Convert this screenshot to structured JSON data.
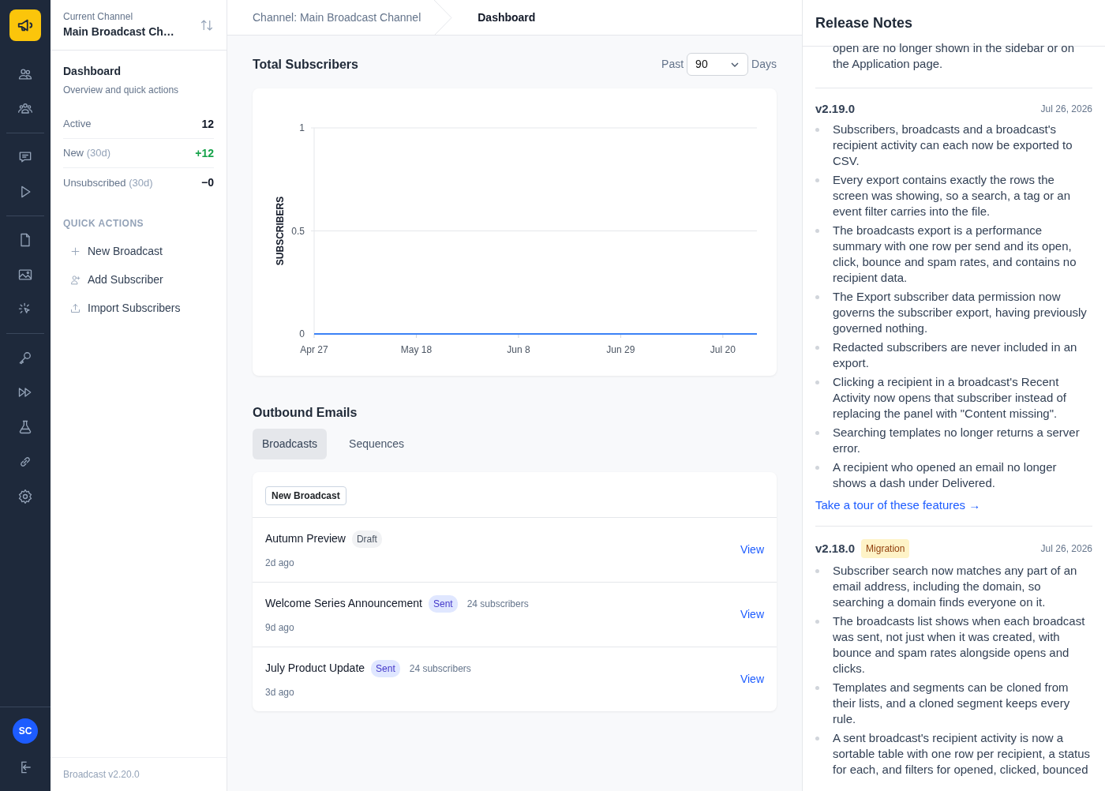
{
  "rail": {
    "avatar": "SC"
  },
  "sidebar": {
    "channel_label": "Current Channel",
    "channel_name": "Main Broadcast Ch…",
    "title": "Dashboard",
    "subtitle": "Overview and quick actions",
    "stats": [
      {
        "label": "Active",
        "value": "12",
        "kind": "plain"
      },
      {
        "label": "New",
        "qualifier": "(30d)",
        "value": "+12",
        "kind": "positive"
      },
      {
        "label": "Unsubscribed",
        "qualifier": "(30d)",
        "value": "−0",
        "kind": "plain"
      }
    ],
    "quick_actions_heading": "QUICK ACTIONS",
    "quick_actions": [
      {
        "label": "New Broadcast",
        "kind": "plus"
      },
      {
        "label": "Add Subscriber",
        "kind": "user"
      },
      {
        "label": "Import Subscribers",
        "kind": "upload"
      }
    ],
    "version": "Broadcast v2.20.0"
  },
  "breadcrumb": [
    "Channel: Main Broadcast Channel",
    "Dashboard"
  ],
  "subscribers": {
    "title": "Total Subscribers",
    "range_prefix": "Past",
    "range_value": "90",
    "range_suffix": "Days",
    "chart_data": {
      "type": "line",
      "ylabel": "SUBSCRIBERS",
      "categories": [
        "Apr 27",
        null,
        null,
        "May 18",
        null,
        null,
        "Jun 8",
        null,
        null,
        "Jun 29",
        null,
        null,
        "Jul 20",
        null
      ],
      "ylim": [
        0,
        1
      ],
      "yticks": [
        0,
        {
          "value": 0.5,
          "label": "0.5"
        },
        1
      ],
      "series": [
        {
          "color": "#3b82f6",
          "values": [
            0,
            0,
            0,
            0,
            0,
            0,
            0,
            0,
            0,
            0,
            0,
            0,
            0,
            0
          ]
        }
      ]
    }
  },
  "outbound": {
    "title": "Outbound Emails",
    "tabs": [
      {
        "label": "Broadcasts",
        "selected": true
      },
      {
        "label": "Sequences",
        "selected": false
      }
    ],
    "new_button": "New Broadcast",
    "broadcasts": [
      {
        "title": "Autumn Preview",
        "status": "Draft",
        "kind": "draft",
        "time": "2d ago",
        "action": "View"
      },
      {
        "title": "Welcome Series Announcement",
        "status": "Sent",
        "kind": "sent",
        "subscribers": "24 subscribers",
        "time": "9d ago",
        "action": "View"
      },
      {
        "title": "July Product Update",
        "status": "Sent",
        "kind": "sent",
        "subscribers": "24 subscribers",
        "time": "3d ago",
        "action": "View"
      }
    ]
  },
  "release_notes": {
    "title": "Release Notes",
    "leading_text": "open are no longer shown in the sidebar or on the Application page.",
    "releases": [
      {
        "version": "v2.19.0",
        "date": "Jul 26, 2026",
        "items": [
          "Subscribers, broadcasts and a broadcast's recipient activity can each now be exported to CSV.",
          "Every export contains exactly the rows the screen was showing, so a search, a tag or an event filter carries into the file.",
          "The broadcasts export is a performance summary with one row per send and its open, click, bounce and spam rates, and contains no recipient data.",
          "The Export subscriber data permission now governs the subscriber export, having previously governed nothing.",
          "Redacted subscribers are never included in an export.",
          "Clicking a recipient in a broadcast's Recent Activity now opens that subscriber instead of replacing the panel with \"Content missing\".",
          "Searching templates no longer returns a server error.",
          "A recipient who opened an email no longer shows a dash under Delivered."
        ],
        "link": "Take a tour of these features →"
      },
      {
        "version": "v2.18.0",
        "tag": "Migration",
        "date": "Jul 26, 2026",
        "items": [
          "Subscriber search now matches any part of an email address, including the domain, so searching a domain finds everyone on it.",
          "The broadcasts list shows when each broadcast was sent, not just when it was created, with bounce and spam rates alongside opens and clicks.",
          "Templates and segments can be cloned from their lists, and a cloned segment keeps every rule.",
          "A sent broadcast's recipient activity is now a sortable table with one row per recipient, a status for each, and filters for opened, clicked, bounced"
        ]
      }
    ]
  }
}
